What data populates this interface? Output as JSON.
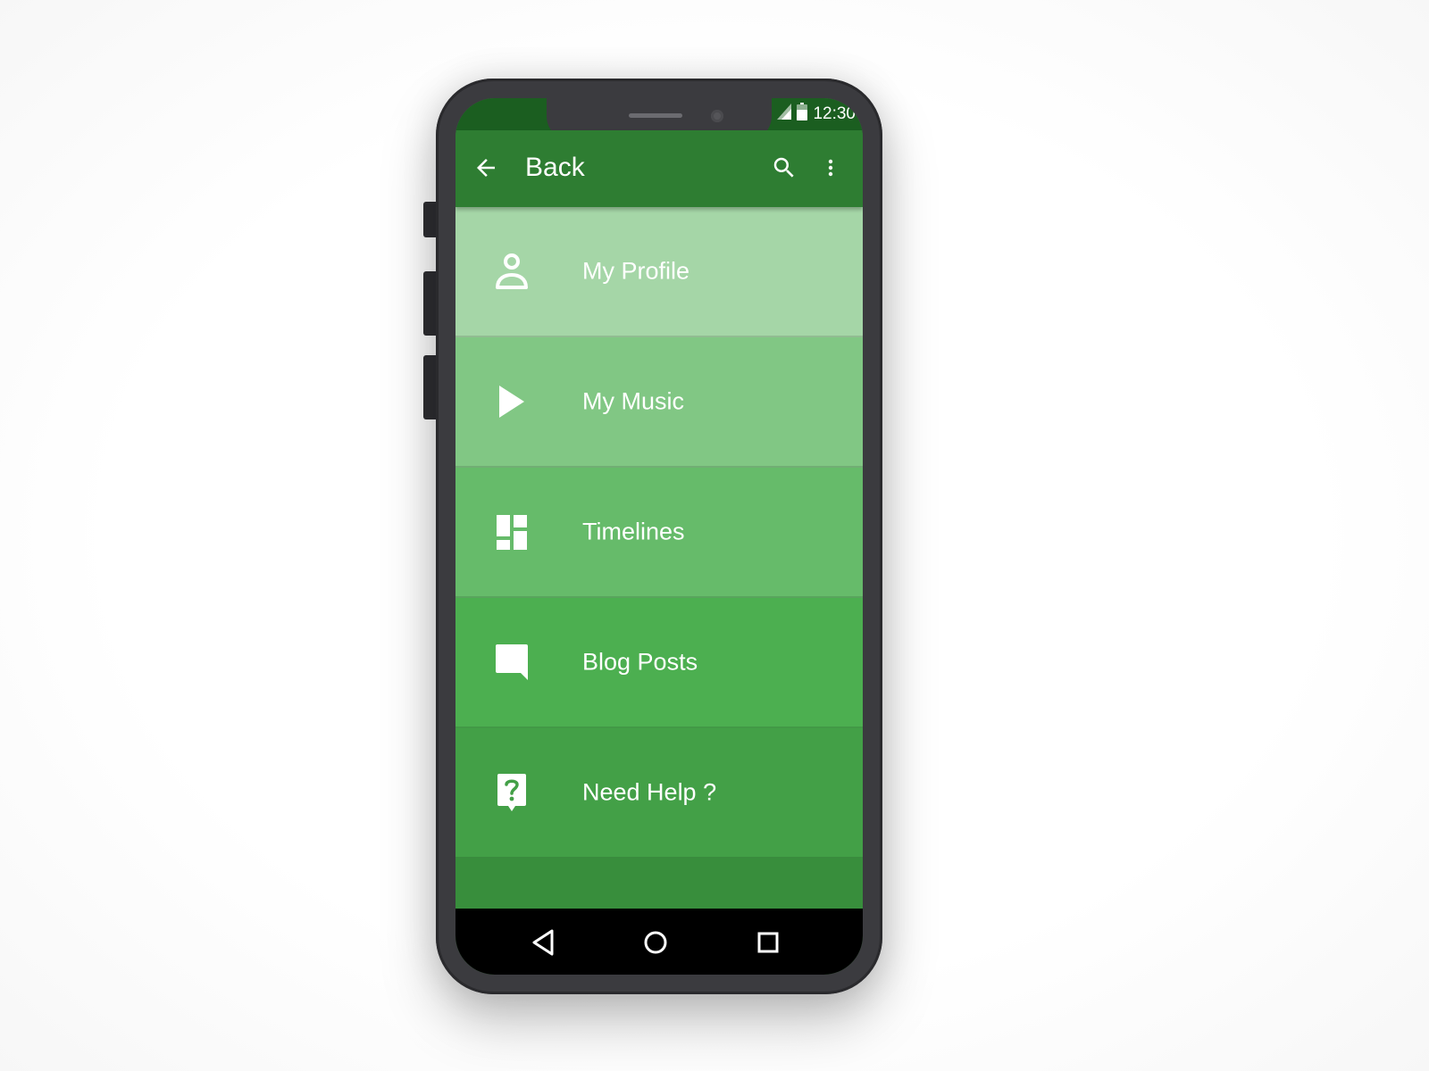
{
  "status_bar": {
    "time": "12:30"
  },
  "app_bar": {
    "back_label": "Back",
    "icons": {
      "back": "arrow-left-icon",
      "search": "search-icon",
      "more": "more-vert-icon"
    }
  },
  "menu": {
    "items": [
      {
        "label": "My Profile",
        "icon": "person-icon",
        "color": "#a5d6a7"
      },
      {
        "label": "My Music",
        "icon": "play-icon",
        "color": "#81c784"
      },
      {
        "label": "Timelines",
        "icon": "dashboard-icon",
        "color": "#66bb6a"
      },
      {
        "label": "Blog Posts",
        "icon": "chat-bubble-icon",
        "color": "#4caf50"
      },
      {
        "label": "Need Help ?",
        "icon": "help-icon",
        "color": "#43a047"
      }
    ]
  },
  "nav_bar": {
    "icons": [
      "back-triangle-icon",
      "home-circle-icon",
      "recents-square-icon"
    ]
  },
  "colors": {
    "status_bar": "#1b5e20",
    "app_bar": "#2e7d32",
    "screen_bottom": "#388e3c",
    "phone_frame": "#3b3b3f"
  }
}
